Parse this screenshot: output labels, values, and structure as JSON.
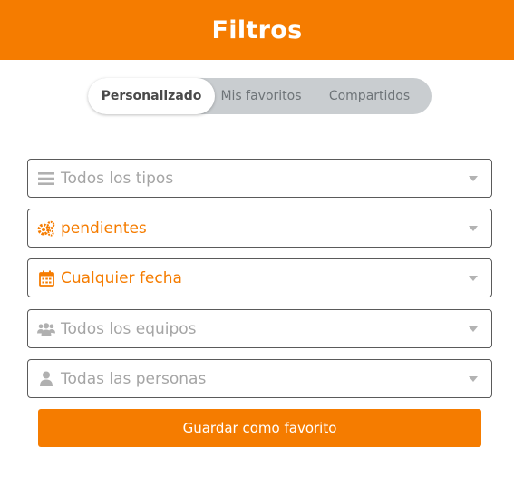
{
  "header": {
    "title": "Filtros"
  },
  "tabs": [
    {
      "label": "Personalizado",
      "active": true
    },
    {
      "label": "Mis favoritos",
      "active": false
    },
    {
      "label": "Compartidos",
      "active": false
    }
  ],
  "filters": [
    {
      "label": "Todos los tipos",
      "icon": "list-icon"
    },
    {
      "label": "pendientes",
      "icon": "gears-icon"
    },
    {
      "label": "Cualquier fecha",
      "icon": "calendar-icon"
    },
    {
      "label": "Todos los equipos",
      "icon": "group-icon"
    },
    {
      "label": "Todas las personas",
      "icon": "person-icon"
    }
  ],
  "save_button": {
    "label": "Guardar como favorito"
  },
  "colors": {
    "accent": "#f57c00",
    "muted": "#a5a5a5",
    "segment_bg": "#c9cdd0"
  }
}
